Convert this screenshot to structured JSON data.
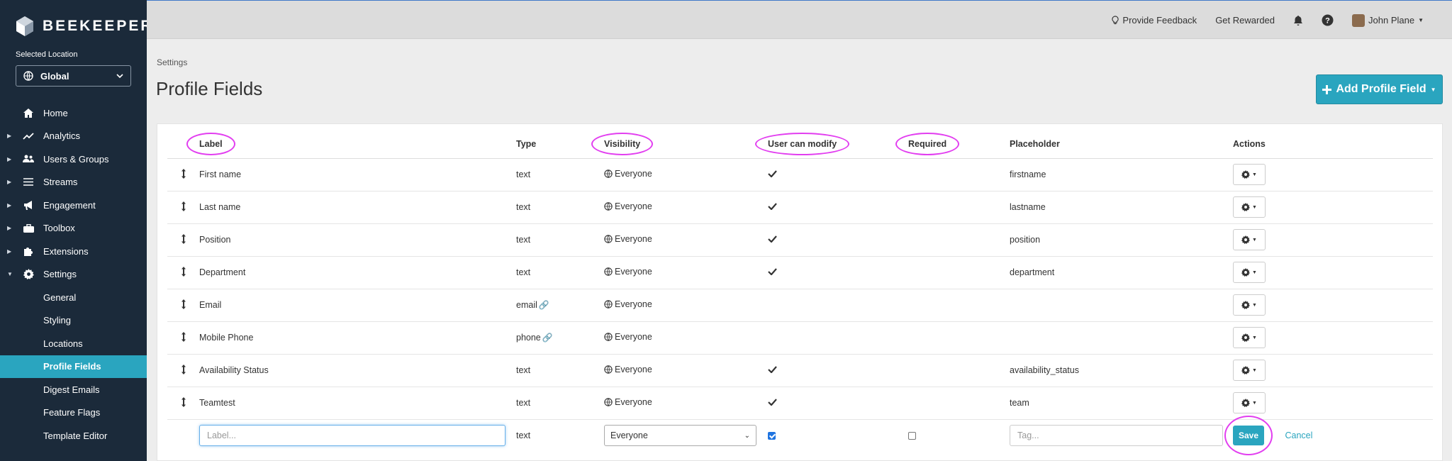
{
  "brand": {
    "name": "BEEKEEPER"
  },
  "sidebar": {
    "selected_location_label": "Selected Location",
    "location_value": "Global",
    "items": [
      {
        "label": "Home",
        "icon": "home-icon",
        "expandable": false
      },
      {
        "label": "Analytics",
        "icon": "chart-line-icon",
        "expandable": true
      },
      {
        "label": "Users & Groups",
        "icon": "users-icon",
        "expandable": true
      },
      {
        "label": "Streams",
        "icon": "list-icon",
        "expandable": true
      },
      {
        "label": "Engagement",
        "icon": "megaphone-icon",
        "expandable": true
      },
      {
        "label": "Toolbox",
        "icon": "toolbox-icon",
        "expandable": true
      },
      {
        "label": "Extensions",
        "icon": "puzzle-icon",
        "expandable": true
      },
      {
        "label": "Settings",
        "icon": "gear-icon",
        "expandable": true,
        "expanded": true
      }
    ],
    "settings_sub": [
      {
        "label": "General"
      },
      {
        "label": "Styling"
      },
      {
        "label": "Locations"
      },
      {
        "label": "Profile Fields",
        "active": true
      },
      {
        "label": "Digest Emails"
      },
      {
        "label": "Feature Flags"
      },
      {
        "label": "Template Editor"
      }
    ]
  },
  "topbar": {
    "feedback": "Provide Feedback",
    "rewarded": "Get Rewarded",
    "user": "John Plane"
  },
  "breadcrumb": "Settings",
  "page_title": "Profile Fields",
  "add_button": "Add Profile Field",
  "table": {
    "headers": {
      "label": "Label",
      "type": "Type",
      "visibility": "Visibility",
      "modify": "User can modify",
      "required": "Required",
      "placeholder": "Placeholder",
      "actions": "Actions"
    },
    "rows": [
      {
        "label": "First name",
        "type": "text",
        "linked": false,
        "visibility": "Everyone",
        "modify": true,
        "placeholder": "firstname"
      },
      {
        "label": "Last name",
        "type": "text",
        "linked": false,
        "visibility": "Everyone",
        "modify": true,
        "placeholder": "lastname"
      },
      {
        "label": "Position",
        "type": "text",
        "linked": false,
        "visibility": "Everyone",
        "modify": true,
        "placeholder": "position"
      },
      {
        "label": "Department",
        "type": "text",
        "linked": false,
        "visibility": "Everyone",
        "modify": true,
        "placeholder": "department"
      },
      {
        "label": "Email",
        "type": "email",
        "linked": true,
        "visibility": "Everyone",
        "modify": false,
        "placeholder": ""
      },
      {
        "label": "Mobile Phone",
        "type": "phone",
        "linked": true,
        "visibility": "Everyone",
        "modify": false,
        "placeholder": ""
      },
      {
        "label": "Availability Status",
        "type": "text",
        "linked": false,
        "visibility": "Everyone",
        "modify": true,
        "placeholder": "availability_status"
      },
      {
        "label": "Teamtest",
        "type": "text",
        "linked": false,
        "visibility": "Everyone",
        "modify": true,
        "placeholder": "team"
      }
    ]
  },
  "new_row": {
    "label_placeholder": "Label...",
    "type": "text",
    "visibility": "Everyone",
    "modify_checked": true,
    "required_checked": false,
    "tag_placeholder": "Tag...",
    "save": "Save",
    "cancel": "Cancel"
  },
  "colors": {
    "accent": "#2aa5bf",
    "sidebar_bg": "#1b2a3a",
    "highlight": "#e23ef0"
  }
}
